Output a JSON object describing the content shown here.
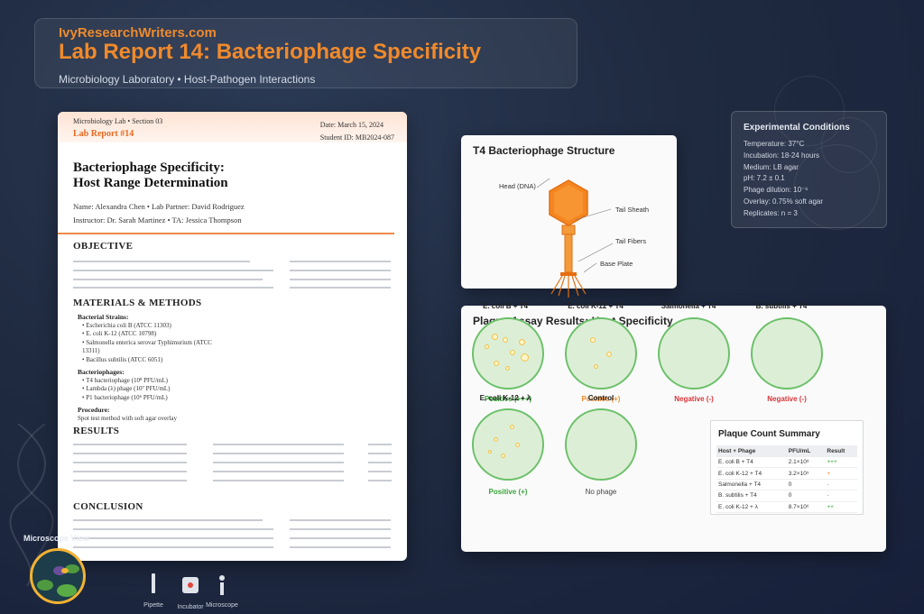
{
  "banner": {
    "brand": "IvyResearchWriters.com",
    "title": "Lab Report 14: Bacteriophage Specificity",
    "subtitle": "Microbiology Laboratory • Host-Pathogen Interactions"
  },
  "report": {
    "course": "Microbiology Lab • Section 03",
    "report_label": "Lab Report #14",
    "date": "Date: March 15, 2024",
    "student_id": "Student ID: MB2024-087",
    "title_line1": "Bacteriophage Specificity:",
    "title_line2": "Host Range Determination",
    "meta_line1": "Name: Alexandra Chen • Lab Partner: David Rodriguez",
    "meta_line2": "Instructor: Dr. Sarah Martinez • TA: Jessica Thompson",
    "objective_heading": "OBJECTIVE",
    "methods_heading": "MATERIALS & METHODS",
    "strains_heading": "Bacterial Strains:",
    "strains": [
      "Escherichia coli B (ATCC 11303)",
      "E. coli K-12 (ATCC 10798)",
      "Salmonella enterica serovar Typhimurium (ATCC 13311)",
      "Bacillus subtilis (ATCC 6051)"
    ],
    "phages_heading": "Bacteriophages:",
    "phages": [
      "T4 bacteriophage (10⁸ PFU/mL)",
      "Lambda (λ) phage (10⁷ PFU/mL)",
      "P1 bacteriophage (10⁶ PFU/mL)"
    ],
    "procedure_heading": "Procedure:",
    "procedure_text": "Spot test method with soft agar overlay",
    "results_heading": "RESULTS",
    "conclusion_heading": "CONCLUSION"
  },
  "structure": {
    "title": "T4 Bacteriophage Structure",
    "labels": [
      "Head (DNA)",
      "Tail Sheath",
      "Tail Fibers",
      "Base Plate"
    ],
    "colors": {
      "head": "#f5861f",
      "sheath": "#f39a3a",
      "fibers": "#e36f12"
    }
  },
  "conditions": {
    "title": "Experimental Conditions",
    "items": [
      "Temperature: 37°C",
      "Incubation: 18-24 hours",
      "Medium: LB agar",
      "pH: 7.2 ± 0.1",
      "Phage dilution: 10⁻⁶",
      "Overlay: 0.75% soft agar",
      "Replicates: n = 3"
    ]
  },
  "assay": {
    "title": "Plaque Assay Results: Host Specificity",
    "dishes": [
      {
        "label": "E. coli B + T4",
        "result": "Positive (+++)",
        "result_color": "#3aa63a"
      },
      {
        "label": "E. coli K-12 + T4",
        "result": "Positive (+)",
        "result_color": "#f08a2c"
      },
      {
        "label": "Salmonella + T4",
        "result": "Negative (-)",
        "result_color": "#d9363a"
      },
      {
        "label": "B. subtilis + T4",
        "result": "Negative (-)",
        "result_color": "#d9363a"
      },
      {
        "label": "E. coli K-12 + λ",
        "result": "Positive (+)",
        "result_color": "#3aa63a"
      },
      {
        "label": "Control",
        "result": "No phage",
        "result_color": "#444444"
      }
    ],
    "summary": {
      "title": "Plaque Count Summary",
      "headers": [
        "Host + Phage",
        "PFU/mL",
        "Result"
      ],
      "rows": [
        [
          "E. coli B + T4",
          "2.1×10⁸",
          "+++"
        ],
        [
          "E. coli K-12 + T4",
          "3.2×10⁵",
          "+"
        ],
        [
          "Salmonella + T4",
          "0",
          "-"
        ],
        [
          "B. subtilis + T4",
          "0",
          "-"
        ],
        [
          "E. coli K-12 + λ",
          "8.7×10⁶",
          "++"
        ]
      ],
      "result_colors": [
        "#3aa63a",
        "#f08a2c",
        "#777777",
        "#777777",
        "#3aa63a"
      ]
    }
  },
  "sidebar": {
    "microscope_label": "Microscope View"
  },
  "tools": [
    "Pipette",
    "Incubator",
    "Microscope"
  ]
}
